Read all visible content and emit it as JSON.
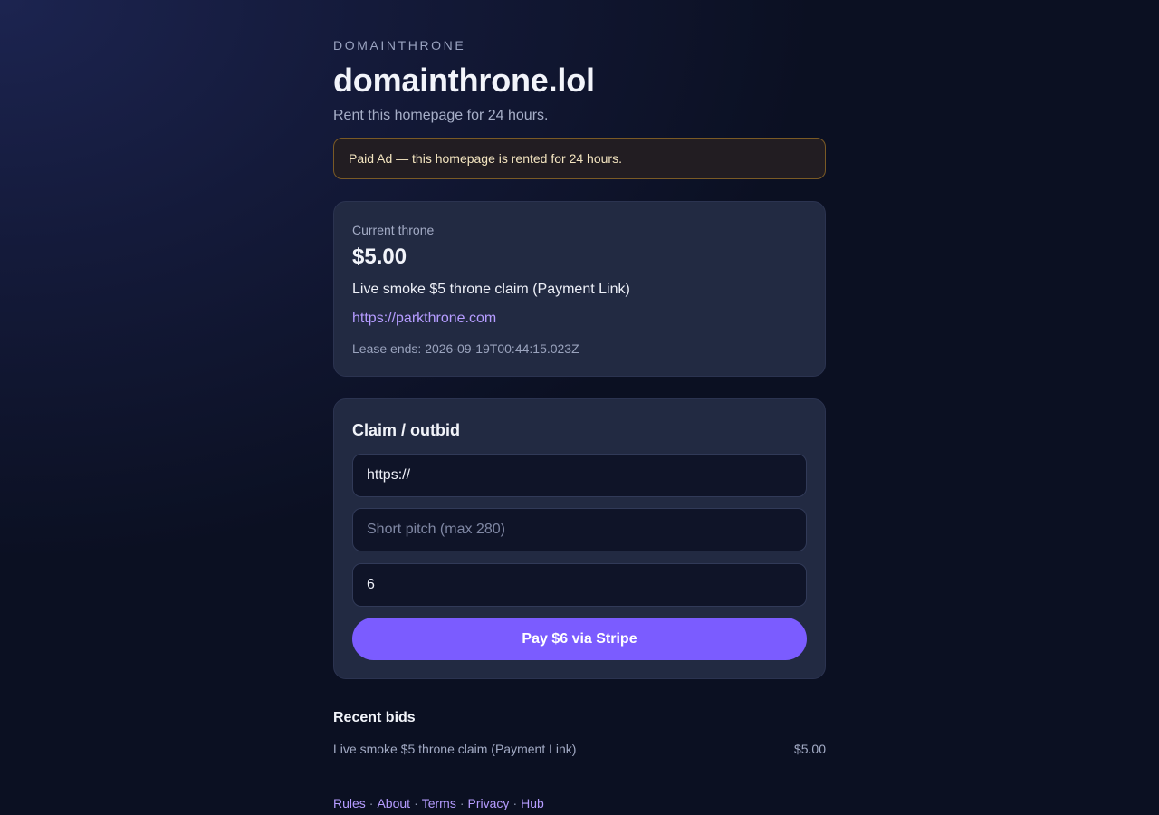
{
  "header": {
    "brand": "DOMAINTHRONE",
    "title": "domainthrone.lol",
    "subtitle": "Rent this homepage for 24 hours."
  },
  "notice": {
    "text": "Paid Ad — this homepage is rented for 24 hours."
  },
  "throne": {
    "label": "Current throne",
    "price": "$5.00",
    "pitch": "Live smoke $5 throne claim (Payment Link)",
    "link": "https://parkthrone.com",
    "lease_label": "Lease ends:",
    "lease_value": "2026-09-19T00:44:15.023Z"
  },
  "claim": {
    "title": "Claim / outbid",
    "url_value": "https://",
    "pitch_placeholder": "Short pitch (max 280)",
    "amount_value": "6",
    "pay_label": "Pay $6 via Stripe"
  },
  "recent": {
    "title": "Recent bids",
    "bids": [
      {
        "pitch": "Live smoke $5 throne claim (Payment Link)",
        "amount": "$5.00"
      }
    ]
  },
  "footer": {
    "links": [
      "Rules",
      "About",
      "Terms",
      "Privacy",
      "Hub"
    ],
    "separator": "·"
  },
  "colors": {
    "accent": "#7b5cff",
    "link": "#b59cff",
    "notice_border": "#7a5a25"
  }
}
